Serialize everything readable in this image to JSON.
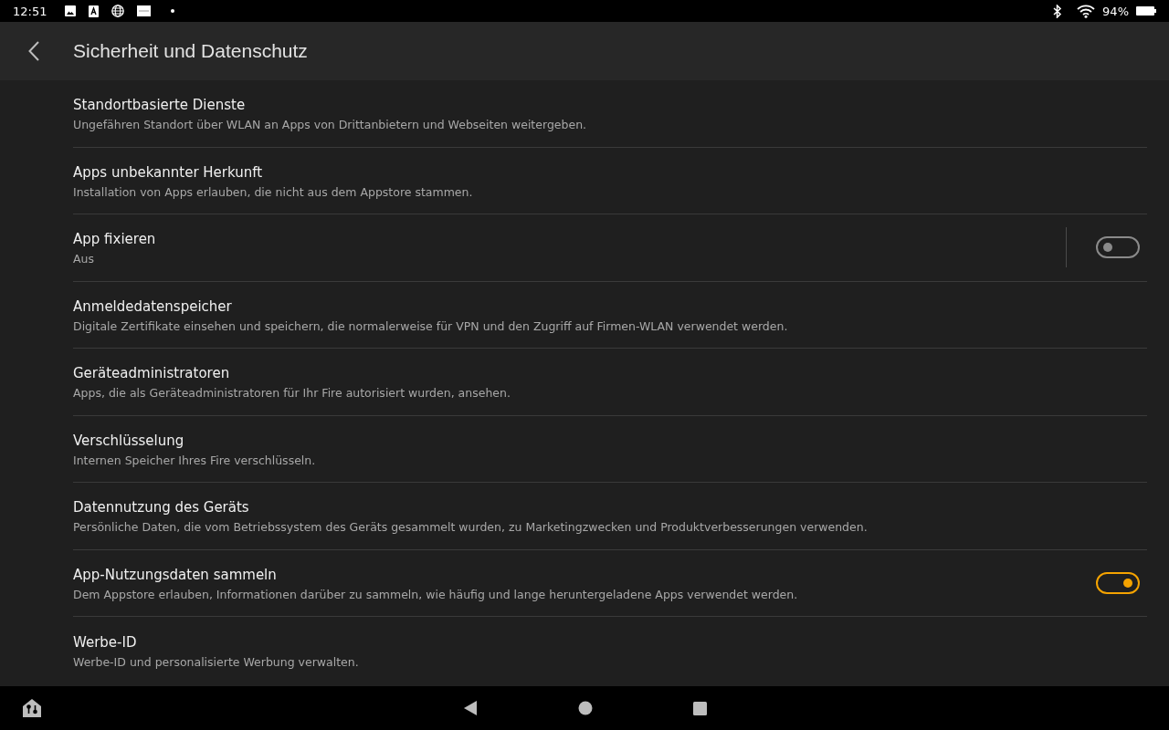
{
  "status_bar": {
    "time": "12:51",
    "battery": "94%"
  },
  "header": {
    "title": "Sicherheit und Datenschutz"
  },
  "settings": [
    {
      "kind": "plain",
      "title": "Standortbasierte Dienste",
      "subtitle": "Ungefähren Standort über WLAN an Apps von Drittanbietern und Webseiten weitergeben."
    },
    {
      "kind": "plain",
      "title": "Apps unbekannter Herkunft",
      "subtitle": "Installation von Apps erlauben, die nicht aus dem Appstore stammen."
    },
    {
      "kind": "split_toggle",
      "title": "App fixieren",
      "subtitle": "Aus",
      "on": false
    },
    {
      "kind": "plain",
      "title": "Anmeldedatenspeicher",
      "subtitle": "Digitale Zertifikate einsehen und speichern, die normalerweise für VPN und den Zugriff auf Firmen-WLAN verwendet werden."
    },
    {
      "kind": "plain",
      "title": "Geräteadministratoren",
      "subtitle": "Apps, die als Geräteadministratoren für Ihr Fire autorisiert wurden, ansehen."
    },
    {
      "kind": "plain",
      "title": "Verschlüsselung",
      "subtitle": "Internen Speicher Ihres Fire verschlüsseln."
    },
    {
      "kind": "plain",
      "title": "Datennutzung des Geräts",
      "subtitle": "Persönliche Daten, die vom Betriebssystem des Geräts gesammelt wurden, zu Marketingzwecken und Produktverbesserungen verwenden."
    },
    {
      "kind": "toggle",
      "title": "App-Nutzungsdaten sammeln",
      "subtitle": "Dem Appstore erlauben, Informationen darüber zu sammeln, wie häufig und lange heruntergeladene Apps verwendet werden.",
      "on": true
    },
    {
      "kind": "plain",
      "title": "Werbe-ID",
      "subtitle": "Werbe-ID und personalisierte Werbung verwalten."
    }
  ]
}
